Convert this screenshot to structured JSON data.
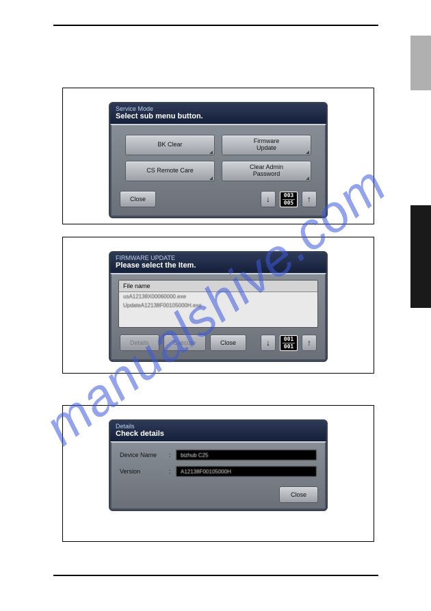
{
  "watermark_text": "manualshive.com",
  "panel1": {
    "title_small": "Service Mode",
    "title_big": "Select sub menu button.",
    "buttons": {
      "bk_clear": "BK Clear",
      "firmware_update": "Firmware Update",
      "cs_remote_care": "CS Remote Care",
      "clear_admin_password": "Clear Admin Password"
    },
    "close": "Close",
    "page_current": "003",
    "page_total": "005"
  },
  "panel2": {
    "title_small": "FIRMWARE UPDATE",
    "title_big": "Please select the Item.",
    "file_header": "File name",
    "files": [
      "usA12138X00060000.exe",
      "UpdateA12138F00105000H.exe"
    ],
    "details": "Details",
    "execute": "Execute",
    "close": "Close",
    "page_current": "001",
    "page_total": "001"
  },
  "panel3": {
    "title_small": "Details",
    "title_big": "Check details",
    "device_name_label": "Device Name",
    "device_name_value": "bizhub C25",
    "version_label": "Version",
    "version_value": "A12138F00105000H",
    "close": "Close"
  }
}
